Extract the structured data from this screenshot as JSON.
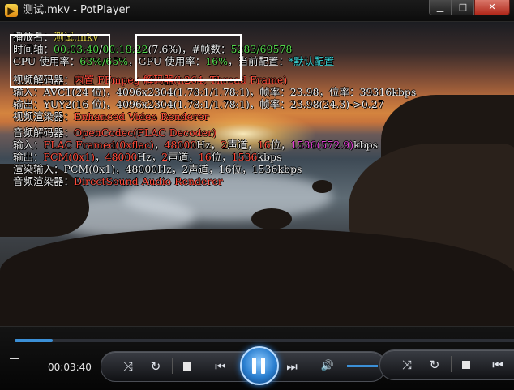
{
  "window": {
    "title": "测试.mkv - PotPlayer",
    "icon": "potplayer-icon",
    "buttons": {
      "min": "▁",
      "max": "□",
      "close": "✕"
    }
  },
  "osd": {
    "line0": {
      "label": "播放名：",
      "value": "测试.mkv"
    },
    "line1": {
      "label": "时间轴：",
      "pos": "00:03:40",
      "sep": "/",
      "dur": "00:18:22",
      "pct": "(7.6%)",
      "frames_label": "，#帧数：",
      "frames": "5283/69578"
    },
    "line2": {
      "cpu_label": "CPU 使用率：",
      "cpu": "63%/65%",
      "gpu_label": "，GPU 使用率：",
      "gpu": "16%",
      "cfg_label": "，当前配置：",
      "cfg": "*默认配置"
    },
    "line3": {
      "label": "视频解码器：",
      "value": "内置 FFmpeg 解码器(h264, Thread Frame)"
    },
    "line4": {
      "text": "输入：AVC1(24 位)，4096x2304(1.78:1/1.78:1)，帧率：23.98，位率：39316kbps"
    },
    "line5": {
      "text": "输出：YUY2(16 位)，4096x2304(1.78:1/1.78:1)，帧率：23.98(24.3)->0.27"
    },
    "line6": {
      "label": "视频渲染器：",
      "value": "Enhanced Video Renderer"
    },
    "line7": {
      "label": "音频解码器：",
      "value": "OpenCodec(FLAC Decoder)"
    },
    "line8": {
      "p1": "输入：",
      "fmt": "FLAC Framed(0xflac)",
      "p2": "，",
      "hz": "48000",
      "p3": "Hz，",
      "ch": "2",
      "p4": "声道，",
      "bits": "16",
      "p5": "位，",
      "rate": "1536(572.9)",
      "p6": "kbps"
    },
    "line9": {
      "p1": "输出：",
      "fmt": "PCM(0x1)",
      "p2": "，",
      "hz": "48000",
      "p3": "Hz，",
      "ch": "2",
      "p4": "声道，",
      "bits": "16",
      "p5": "位，",
      "rate": "1536",
      "p6": "kbps"
    },
    "line10": {
      "text": "渲染输入：PCM(0x1)，48000Hz，2声道，16位，1536kbps"
    },
    "line11": {
      "label": "音频渲染器：",
      "value": "DirectSound Audio Renderer"
    }
  },
  "controls": {
    "time": "00:03:40",
    "progress_fraction": 0.076,
    "icons": {
      "shuffle": "⤨",
      "repeat": "↻",
      "prev": "⏮",
      "next": "⏭",
      "volume": "🔊"
    }
  },
  "colors": {
    "accent": "#3b8fd6",
    "osd_green": "#52d64a",
    "osd_cyan": "#38d3d6",
    "osd_red": "#ff4a3a",
    "osd_magenta": "#e23bd4"
  }
}
